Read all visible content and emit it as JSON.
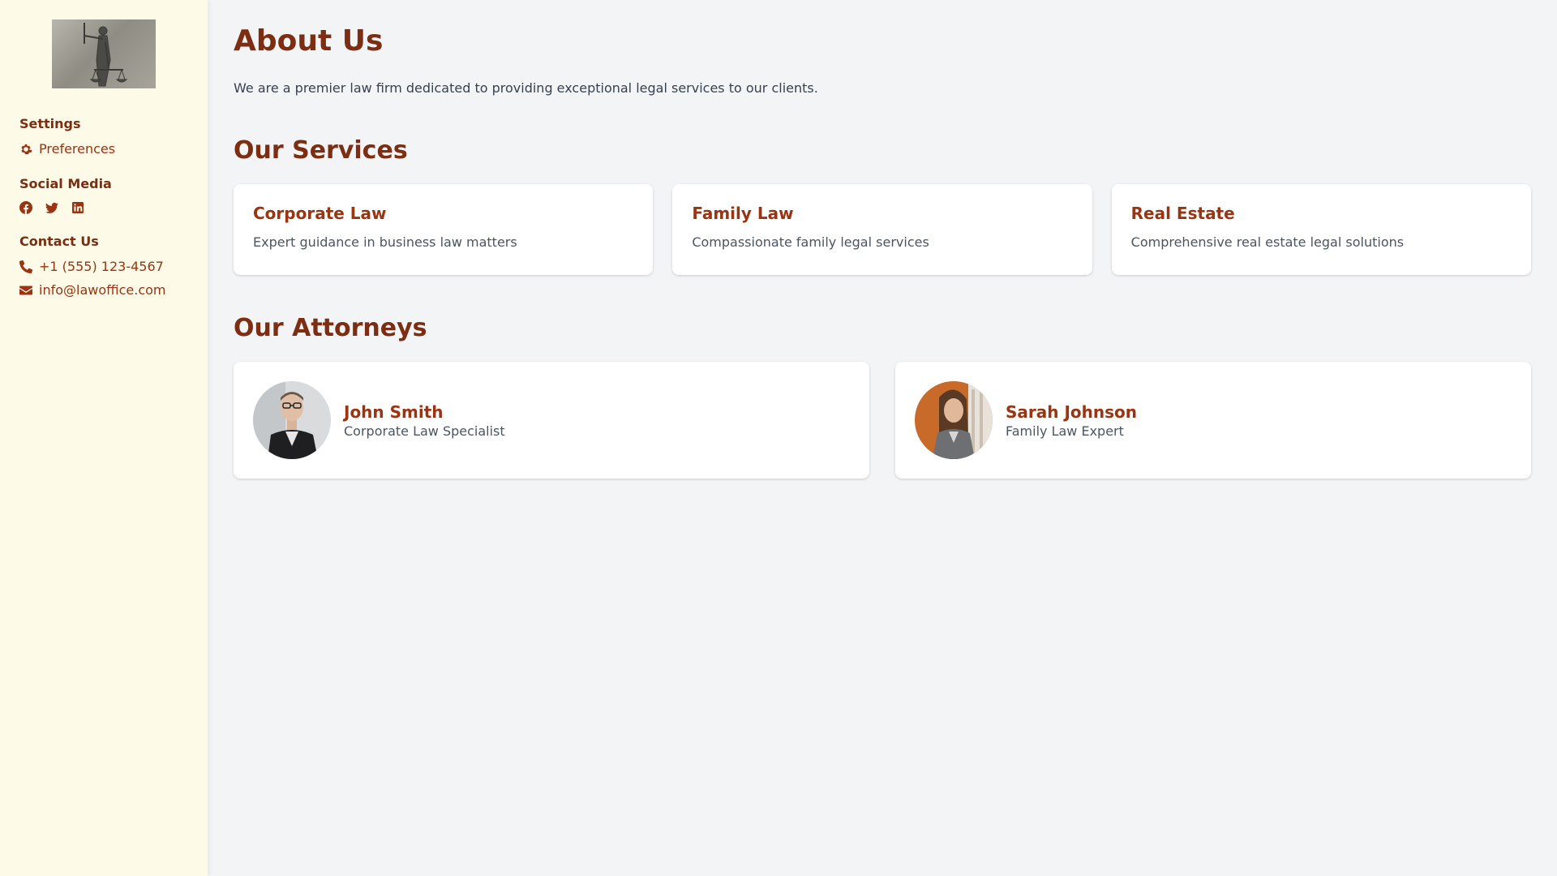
{
  "sidebar": {
    "settings": {
      "title": "Settings",
      "preferences_label": "Preferences"
    },
    "social": {
      "title": "Social Media",
      "icons": [
        "facebook-icon",
        "twitter-icon",
        "linkedin-icon"
      ]
    },
    "contact": {
      "title": "Contact Us",
      "phone": "+1 (555) 123-4567",
      "email": "info@lawoffice.com"
    }
  },
  "main": {
    "about": {
      "title": "About Us",
      "text": "We are a premier law firm dedicated to providing exceptional legal services to our clients."
    },
    "services": {
      "title": "Our Services",
      "items": [
        {
          "title": "Corporate Law",
          "desc": "Expert guidance in business law matters"
        },
        {
          "title": "Family Law",
          "desc": "Compassionate family legal services"
        },
        {
          "title": "Real Estate",
          "desc": "Comprehensive real estate legal solutions"
        }
      ]
    },
    "attorneys": {
      "title": "Our Attorneys",
      "items": [
        {
          "name": "John Smith",
          "role": "Corporate Law Specialist"
        },
        {
          "name": "Sarah Johnson",
          "role": "Family Law Expert"
        }
      ]
    }
  },
  "colors": {
    "sidebar_bg": "#fefae8",
    "heading": "#7c2d12",
    "accent": "#9a3412",
    "page_bg": "#f3f4f6"
  }
}
